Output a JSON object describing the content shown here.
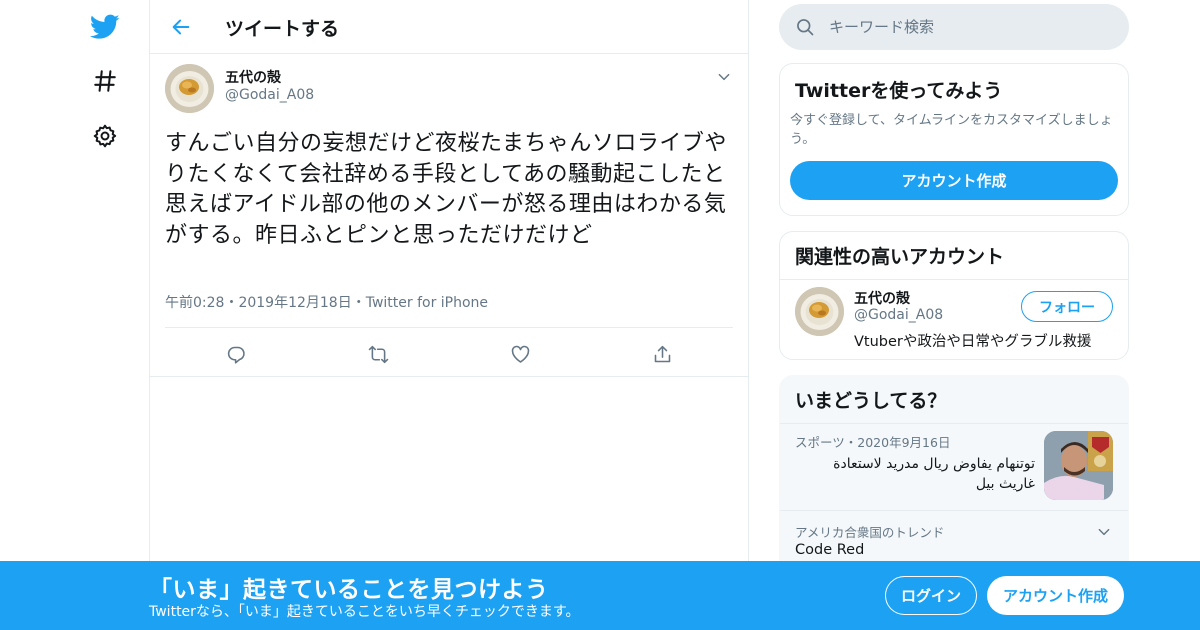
{
  "colors": {
    "accent": "#1da1f2",
    "text": "#14171a",
    "muted": "#657786",
    "border": "#e6ecf0"
  },
  "nav": {
    "icons": [
      "twitter-bird-icon",
      "hashtag-icon",
      "settings-gear-icon"
    ]
  },
  "header": {
    "title": "ツイートする"
  },
  "tweet": {
    "author_name": "五代の殻",
    "author_handle": "@Godai_A08",
    "text": "すんごい自分の妄想だけど夜桜たまちゃんソロライブやりたくなくて会社辞める手段としてあの騒動起こしたと思えばアイドル部の他のメンバーが怒る理由はわかる気がする。昨日ふとピンと思っただけだけど",
    "time": "午前0:28",
    "date": "2019年12月18日",
    "source": "Twitter for iPhone",
    "separator": "・"
  },
  "search": {
    "placeholder": "キーワード検索"
  },
  "signup_card": {
    "title": "Twitterを使ってみよう",
    "description": "今すぐ登録して、タイムラインをカスタマイズしましょう。",
    "button": "アカウント作成"
  },
  "related_card": {
    "title": "関連性の高いアカウント",
    "name": "五代の殻",
    "handle": "@Godai_A08",
    "bio": "Vtuberや政治や日常やグラブル救援",
    "follow_button": "フォロー"
  },
  "trends_card": {
    "title": "いまどうしてる？",
    "trend1": {
      "category": "スポーツ",
      "date": "2020年9月16日",
      "text": "توتنهام يفاوض ريال مدريد لاستعادة غاريث بيل"
    },
    "trend2": {
      "context": "アメリカ合衆国のトレンド",
      "name": "Code Red"
    }
  },
  "banner": {
    "title": "「いま」起きていることを見つけよう",
    "subtitle": "Twitterなら、「いま」起きていることをいち早くチェックできます。",
    "login": "ログイン",
    "signup": "アカウント作成"
  }
}
